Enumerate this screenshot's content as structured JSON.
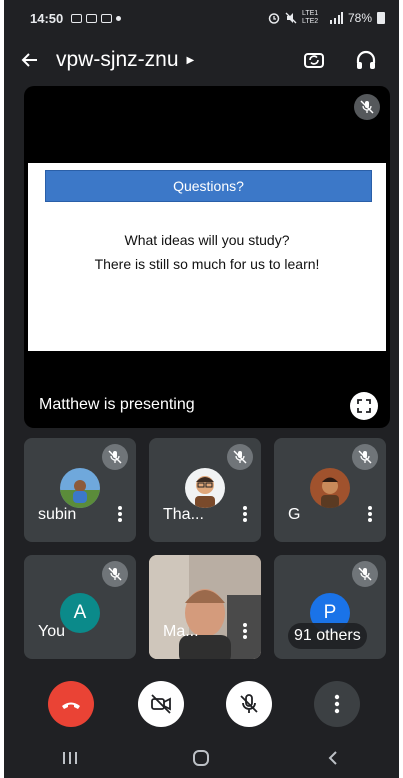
{
  "status_bar": {
    "time": "14:50",
    "network": "LTE1 LTE2",
    "battery": "78%"
  },
  "header": {
    "meeting_code": "vpw-sjnz-znu"
  },
  "presentation": {
    "slide_heading": "Questions?",
    "slide_line_1": "What ideas will you study?",
    "slide_line_2": "There is still so much for us to learn!",
    "presenter_label": "Matthew is presenting"
  },
  "participants": [
    {
      "name": "subin"
    },
    {
      "name": "Tha..."
    },
    {
      "name": "G"
    },
    {
      "name": "You",
      "initial": "A"
    },
    {
      "name": "Ma..."
    },
    {
      "name": "91 others",
      "initial": "P"
    }
  ],
  "colors": {
    "end_call": "#ea4335",
    "you_avatar": "#0b8a8a",
    "others_avatar": "#1a73e8",
    "background": "#202124",
    "tile": "#3c4043"
  }
}
